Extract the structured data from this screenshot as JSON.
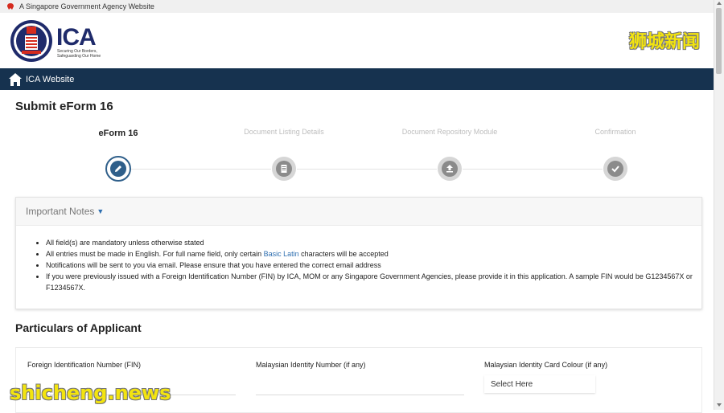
{
  "gov_bar": {
    "text": "A Singapore Government Agency Website"
  },
  "header": {
    "logo": "ICA",
    "tagline": "Securing Our Borders, Safeguarding Our Home",
    "watermark_cn": "狮城新闻"
  },
  "navbar": {
    "label": "ICA Website"
  },
  "page": {
    "title": "Submit eForm 16"
  },
  "stepper": {
    "steps": [
      {
        "label": "eForm 16",
        "icon": "pencil-icon",
        "active": true
      },
      {
        "label": "Document Listing Details",
        "icon": "document-list-icon",
        "active": false
      },
      {
        "label": "Document Repository Module",
        "icon": "upload-icon",
        "active": false
      },
      {
        "label": "Confirmation",
        "icon": "check-icon",
        "active": false
      }
    ]
  },
  "notes": {
    "title": "Important Notes",
    "items": [
      "All field(s) are mandatory unless otherwise stated",
      {
        "before": "All entries must be made in English. For full name field, only certain ",
        "link": "Basic Latin",
        "after": " characters will be accepted"
      },
      "Notifications will be sent to you via email. Please ensure that you have entered the correct email address",
      "If you were previously issued with a Foreign Identification Number (FIN) by ICA, MOM or any Singapore Government Agencies, please provide it in this application. A sample FIN would be G1234567X or F1234567X."
    ]
  },
  "applicant": {
    "section_title": "Particulars of Applicant",
    "fin_label": "Foreign Identification Number (FIN)",
    "fin_value": "",
    "my_id_label": "Malaysian Identity Number (if any)",
    "my_id_value": "",
    "card_colour_label": "Malaysian Identity Card Colour (if any)",
    "card_colour_selected": "Select Here"
  },
  "watermark": {
    "text": "shicheng.news"
  },
  "colors": {
    "navbar": "#16324f",
    "accent": "#2f5f8a",
    "link": "#2f6fb0",
    "watermark": "#f3e40f"
  }
}
